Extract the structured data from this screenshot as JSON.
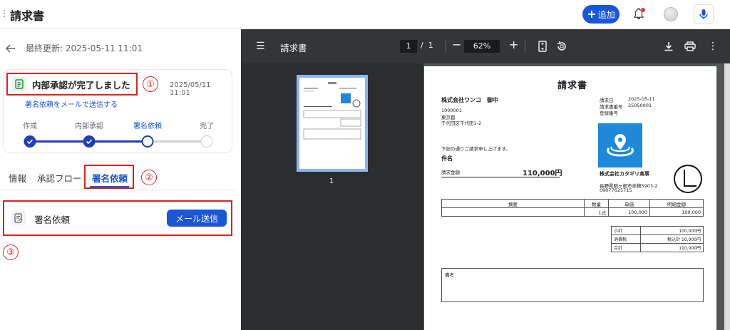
{
  "header": {
    "menu_glyph": "⋮",
    "title": "請求書",
    "add_label": "追加",
    "add_icon": "plus-icon",
    "accent": "#1a56d6"
  },
  "left": {
    "last_updated": "最終更新: 2025-05-11 11:01",
    "status": {
      "title": "内部承認が完了しました",
      "date": "2025/05/11 11:01",
      "mail_link": "署名依頼をメールで送信する"
    },
    "steps": [
      {
        "label": "作成",
        "state": "done"
      },
      {
        "label": "内部承認",
        "state": "done"
      },
      {
        "label": "署名依頼",
        "state": "current"
      },
      {
        "label": "完了",
        "state": "pending"
      }
    ],
    "tabs": [
      "情報",
      "承認フロー",
      "署名依頼"
    ],
    "active_tab": "署名依頼",
    "sign_request": {
      "label": "署名依頼",
      "button": "メール送信"
    },
    "annotations": [
      "①",
      "②",
      "③"
    ],
    "annotation_color": "#e02020"
  },
  "viewer": {
    "title": "請求書",
    "current_page": "1",
    "page_sep": "/",
    "total_pages": "1",
    "zoom": "62%",
    "zoom_minus": "−",
    "zoom_plus": "+",
    "thumb_page": "1"
  },
  "invoice": {
    "title": "請求書",
    "customer": "株式会社ワンコ　御中",
    "postal": "1000001",
    "city": "東京都",
    "address": "千代田区千代田1-2",
    "issue_date_label": "請求日",
    "issue_date": "2025-05-11",
    "number_label": "請求書番号",
    "number": "25050001",
    "reg_label": "登録番号",
    "message": "下記の通りご請求申し上げます。",
    "subject_label": "件名",
    "amount_label": "請求金額",
    "amount": "110,000円",
    "issuer": "株式会社カタギリ商事",
    "issuer_address": "長野県駒ヶ根市赤穂5903-2",
    "issuer_phone": "09077625715",
    "columns": [
      "摘要",
      "数量",
      "単価",
      "明細金額"
    ],
    "rows": [
      {
        "desc": "",
        "qty": "1式",
        "price": "100,000",
        "amount": "100,000"
      }
    ],
    "subtotal_label": "小計",
    "subtotal": "100,000円",
    "tax_label": "消費税",
    "tax": "税込計 10,000円",
    "total_label": "合計",
    "total": "110,000円",
    "notes_label": "備考"
  }
}
